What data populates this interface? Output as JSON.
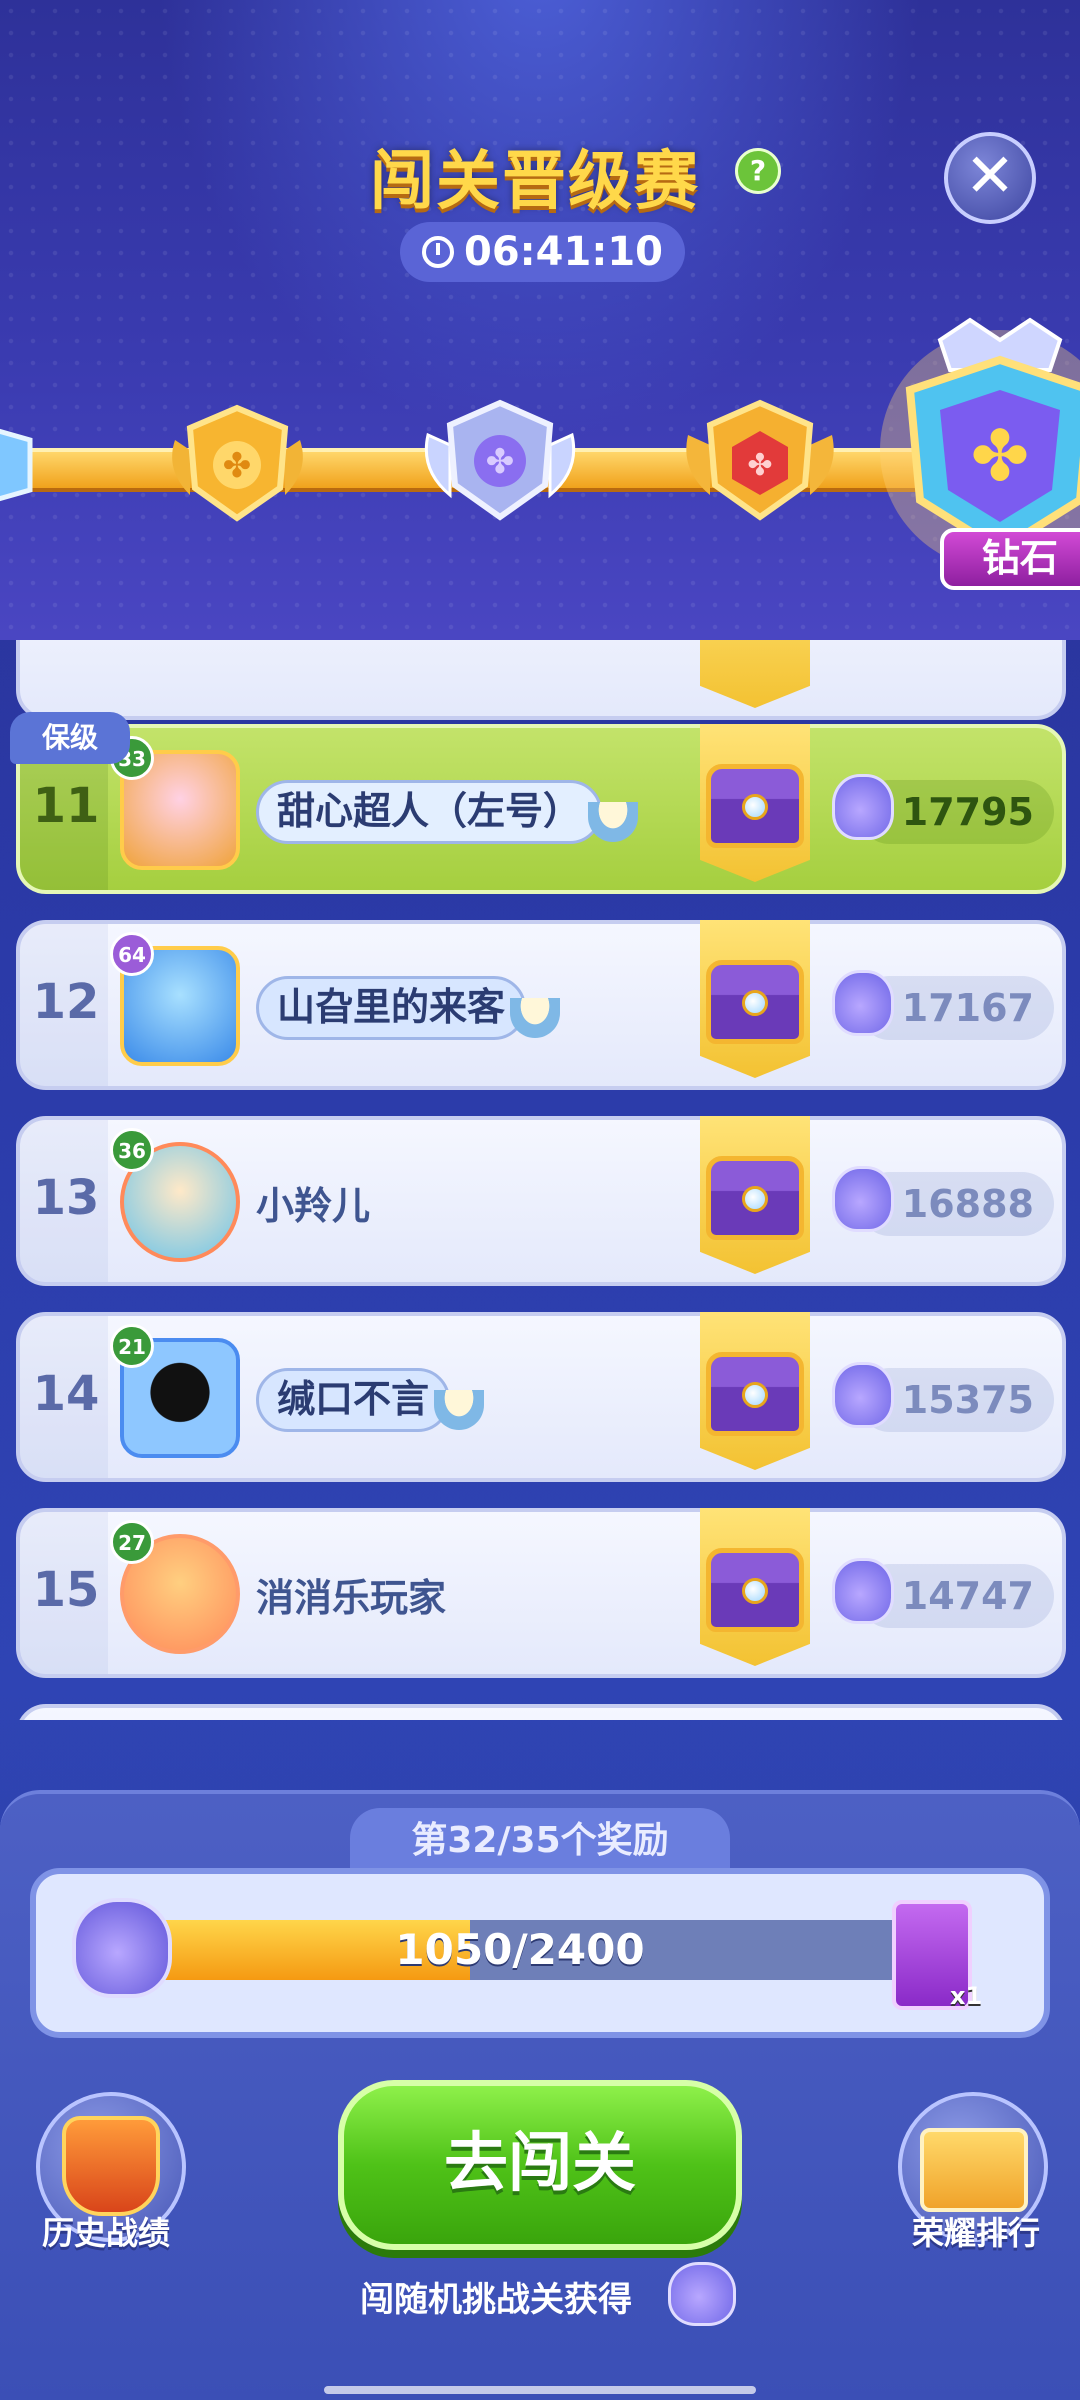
{
  "header": {
    "title": "闯关晋级赛",
    "help": "?",
    "close": "✕",
    "timer": "06:41:10"
  },
  "tiers": {
    "current_label": "钻石"
  },
  "protect_tag": "保级",
  "leaderboard": [
    {
      "rank": "11",
      "level": "33",
      "name": "甜心超人（左号）",
      "score": "17795",
      "highlight": true
    },
    {
      "rank": "12",
      "level": "64",
      "name": "山旮里的来客",
      "score": "17167"
    },
    {
      "rank": "13",
      "level": "36",
      "name": "小羚儿",
      "score": "16888"
    },
    {
      "rank": "14",
      "level": "21",
      "name": "缄口不言",
      "score": "15375"
    },
    {
      "rank": "15",
      "level": "27",
      "name": "消消乐玩家",
      "score": "14747"
    }
  ],
  "reward": {
    "tab_label": "第32/35个奖励",
    "progress_text": "1050/2400",
    "progress_fraction": 0.4375,
    "prize_count": "x1"
  },
  "footer": {
    "history_label": "历史战绩",
    "rank_label": "荣耀排行",
    "go_label": "去闯关",
    "hint": "闯随机挑战关获得"
  }
}
